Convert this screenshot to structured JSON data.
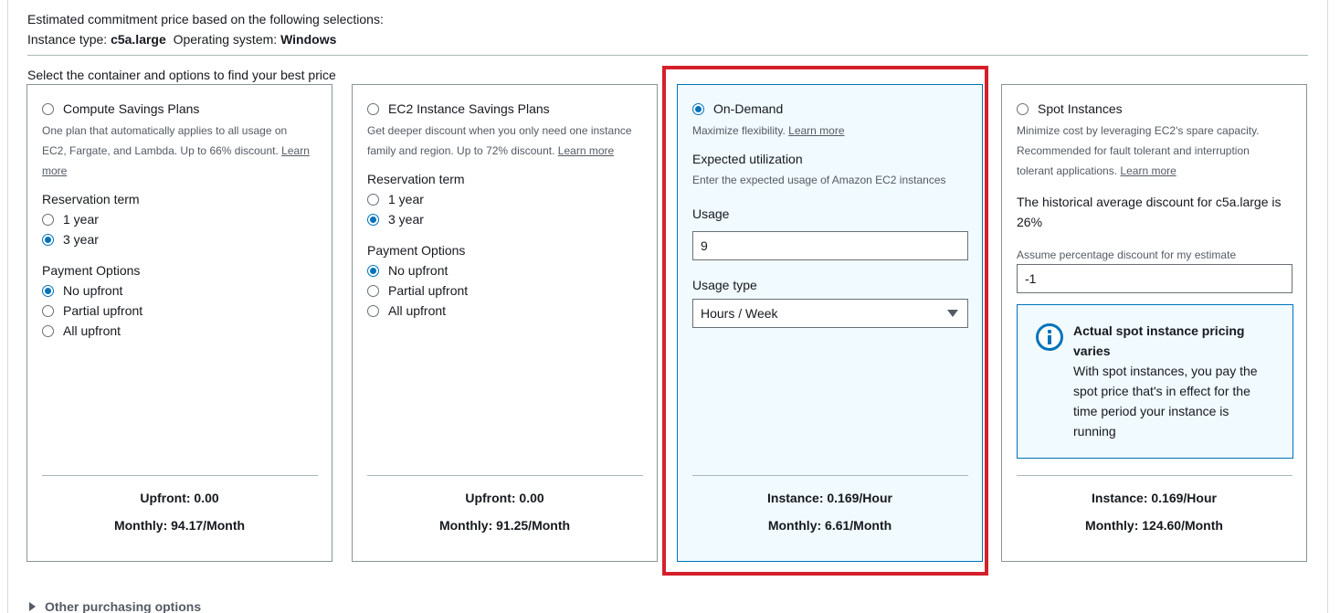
{
  "summary": {
    "heading": "Estimated commitment price based on the following selections:",
    "instance_type_label": "Instance type:",
    "instance_type_value": "c5a.large",
    "os_label": "Operating system:",
    "os_value": "Windows"
  },
  "select_label": "Select the container and options to find your best price",
  "cards": {
    "compute_sp": {
      "title": "Compute Savings Plans",
      "desc_line1": "One plan that automatically applies to all usage on",
      "desc_line2": "EC2, Fargate, and Lambda. Up to 66% discount.",
      "learn_more_1": "Learn",
      "learn_more_2": "more",
      "term_label": "Reservation term",
      "term_options": [
        "1 year",
        "3 year"
      ],
      "term_selected": "3 year",
      "payment_label": "Payment Options",
      "payment_options": [
        "No upfront",
        "Partial upfront",
        "All upfront"
      ],
      "payment_selected": "No upfront",
      "footer_line1": "Upfront: 0.00",
      "footer_line2": "Monthly: 94.17/Month"
    },
    "ec2_sp": {
      "title": "EC2 Instance Savings Plans",
      "desc_line1": "Get deeper discount when you only need one instance",
      "desc_line2": "family and region. Up to 72% discount.",
      "learn_more": "Learn more",
      "term_label": "Reservation term",
      "term_options": [
        "1 year",
        "3 year"
      ],
      "term_selected": "3 year",
      "payment_label": "Payment Options",
      "payment_options": [
        "No upfront",
        "Partial upfront",
        "All upfront"
      ],
      "payment_selected": "No upfront",
      "footer_line1": "Upfront: 0.00",
      "footer_line2": "Monthly: 91.25/Month"
    },
    "on_demand": {
      "title": "On-Demand",
      "desc": "Maximize flexibility.",
      "learn_more": "Learn more",
      "utilization_label": "Expected utilization",
      "utilization_desc": "Enter the expected usage of Amazon EC2 instances",
      "usage_label": "Usage",
      "usage_value": "9",
      "usage_type_label": "Usage type",
      "usage_type_value": "Hours / Week",
      "footer_line1": "Instance: 0.169/Hour",
      "footer_line2": "Monthly: 6.61/Month"
    },
    "spot": {
      "title": "Spot Instances",
      "desc_line1": "Minimize cost by leveraging EC2's spare capacity.",
      "desc_line2": "Recommended for fault tolerant and interruption",
      "desc_line3": "tolerant applications.",
      "learn_more": "Learn more",
      "historical_line1": "The historical average discount for c5a.large is",
      "historical_line2": "26%",
      "assume_label": "Assume percentage discount for my estimate",
      "assume_value": "-1",
      "alert_title": "Actual spot instance pricing varies",
      "alert_body": "With spot instances, you pay the spot price that's in effect for the time period your instance is running",
      "footer_line1": "Instance: 0.169/Hour",
      "footer_line2": "Monthly: 124.60/Month"
    }
  },
  "selected_option": "On-Demand",
  "other_purchasing_options": "Other purchasing options",
  "colors": {
    "accent": "#0073bb",
    "highlight": "#d4202b",
    "selected_bg": "#f1faff"
  },
  "icons": {
    "info": "info-circle-icon",
    "expand": "caret-right-icon",
    "dropdown": "caret-down-icon"
  }
}
